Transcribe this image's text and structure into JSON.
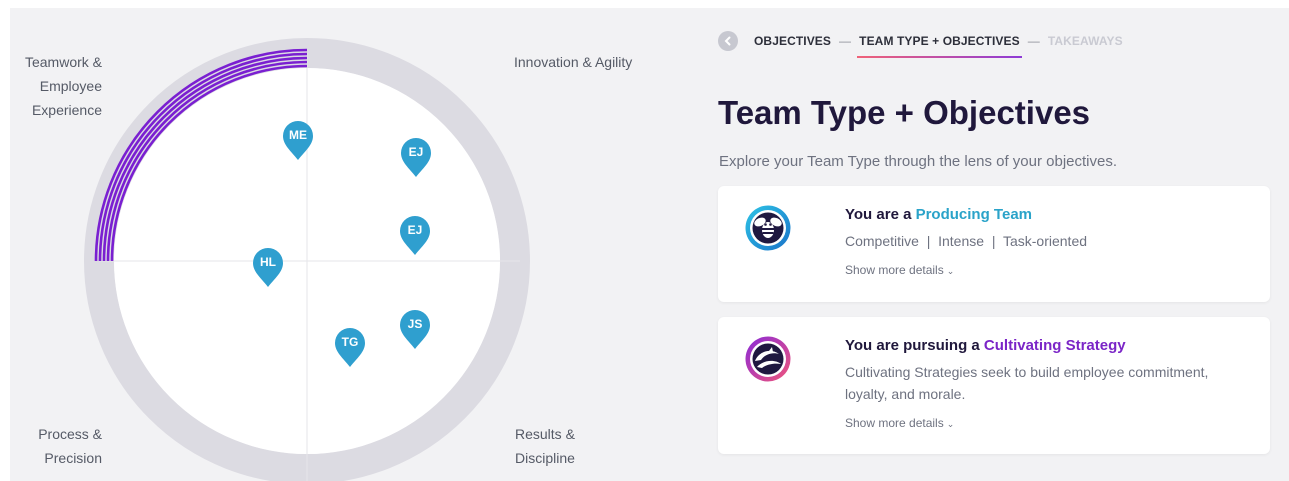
{
  "quadrants": {
    "top_left": [
      "Teamwork &",
      "Employee",
      "Experience"
    ],
    "top_right": "Innovation & Agility",
    "bottom_left": [
      "Process &",
      "Precision"
    ],
    "bottom_right": [
      "Results &",
      "Discipline"
    ]
  },
  "members": [
    {
      "initials": "ME"
    },
    {
      "initials": "EJ"
    },
    {
      "initials": "EJ"
    },
    {
      "initials": "HL"
    },
    {
      "initials": "JS"
    },
    {
      "initials": "TG"
    }
  ],
  "colors": {
    "pin": "#2f9fcf",
    "arc": "#7a1fd1",
    "ring": "#dedde4",
    "accent_blue": "#2aa3c9",
    "accent_purple": "#7b25c7",
    "title": "#20183c"
  },
  "stepper": {
    "steps": [
      {
        "label": "OBJECTIVES",
        "state": "done"
      },
      {
        "label": "TEAM TYPE + OBJECTIVES",
        "state": "active"
      },
      {
        "label": "TAKEAWAYS",
        "state": "upcoming"
      }
    ],
    "separator": "—"
  },
  "page": {
    "title": "Team Type + Objectives",
    "subtitle": "Explore your Team Type through the lens of your objectives."
  },
  "cards": [
    {
      "icon": "bee-icon",
      "prefix": "You are a ",
      "highlight": "Producing Team",
      "description": "Competitive  |  Intense  |  Task-oriented",
      "more": "Show more details"
    },
    {
      "icon": "dolphins-icon",
      "prefix": "You are pursuing a ",
      "highlight": "Cultivating Strategy",
      "description": "Cultivating Strategies seek to build employee commitment, loyalty, and morale.",
      "more": "Show more details"
    }
  ]
}
